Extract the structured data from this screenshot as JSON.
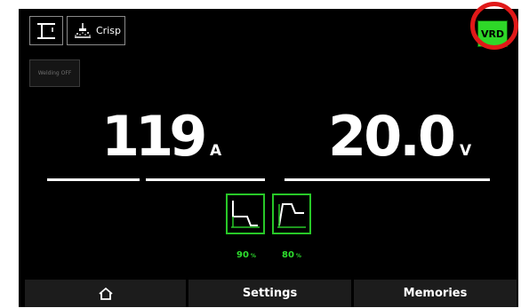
{
  "top_bar": {
    "process_icon": "mig-gun-icon",
    "arc_mode_icon": "spatter-icon",
    "arc_mode_label": "Crisp"
  },
  "status": {
    "welding_state": "Welding OFF",
    "vrd_label": "VRD",
    "vrd_color": "#2ed828"
  },
  "readings": {
    "current_value": "119",
    "current_unit": "A",
    "voltage_value": "20.0",
    "voltage_unit": "V"
  },
  "waveforms": [
    {
      "icon": "down-slope-waveform-icon",
      "percent": "90",
      "unit": "%"
    },
    {
      "icon": "pulse-waveform-icon",
      "percent": "80",
      "unit": "%"
    }
  ],
  "footer": {
    "home_icon": "home-icon",
    "settings_label": "Settings",
    "memories_label": "Memories"
  },
  "colors": {
    "accent_green": "#2ee02e",
    "highlight_ring": "#e01818",
    "background": "#000000"
  }
}
